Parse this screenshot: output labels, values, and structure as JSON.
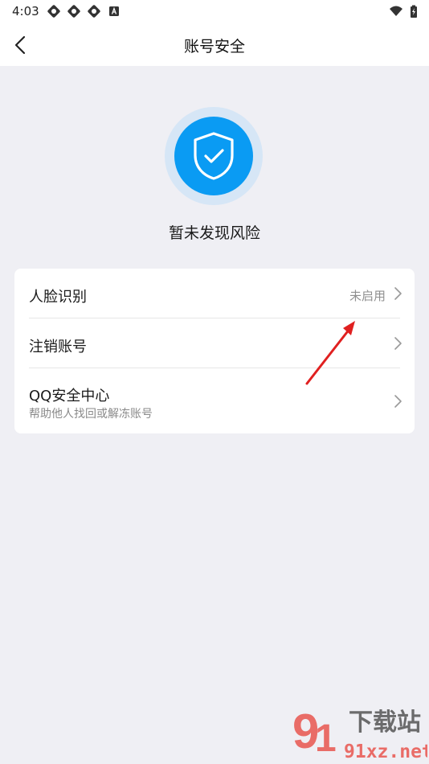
{
  "status_bar": {
    "time": "4:03",
    "icons": [
      "app-notification-icon",
      "app-notification-icon",
      "app-notification-icon",
      "a-notification-icon",
      "wifi-icon",
      "battery-charging-icon"
    ]
  },
  "header": {
    "title": "账号安全",
    "back_icon": "chevron-left-icon"
  },
  "hero": {
    "icon": "shield-check-icon",
    "status_text": "暂未发现风险",
    "colors": {
      "shield_blue": "#0a9bf3",
      "halo": "#d6e6f6"
    }
  },
  "settings": {
    "items": [
      {
        "title": "人脸识别",
        "value": "未启用",
        "icon": "chevron-right-icon"
      },
      {
        "title": "注销账号",
        "icon": "chevron-right-icon"
      },
      {
        "title": "QQ安全中心",
        "subtitle": "帮助他人找回或解冻账号",
        "icon": "chevron-right-icon"
      }
    ]
  },
  "annotation": {
    "icon": "red-arrow-icon",
    "color": "#e02020"
  },
  "watermark": {
    "text": "91下载站 91xz.net"
  }
}
